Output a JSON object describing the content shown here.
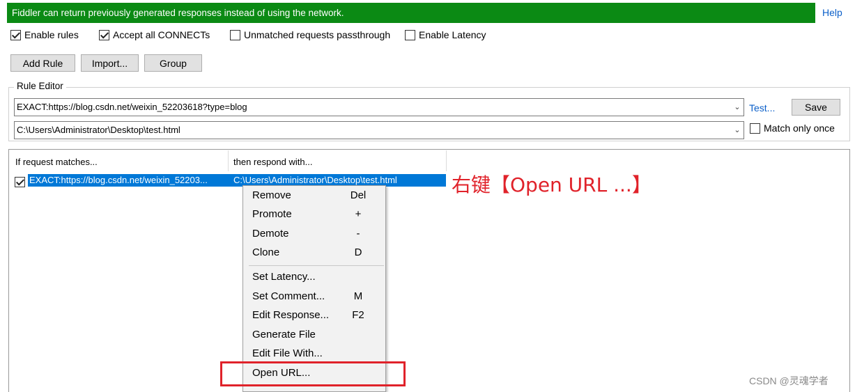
{
  "banner": {
    "text": "Fiddler can return previously generated responses instead of using the network."
  },
  "help": {
    "label": "Help"
  },
  "options": [
    {
      "label": "Enable rules",
      "checked": true
    },
    {
      "label": "Accept all CONNECTs",
      "checked": true
    },
    {
      "label": "Unmatched requests passthrough",
      "checked": false
    },
    {
      "label": "Enable Latency",
      "checked": false
    }
  ],
  "toolbar": {
    "add_rule_label": "Add Rule",
    "import_label": "Import...",
    "group_label": "Group"
  },
  "rule_editor": {
    "title": "Rule Editor",
    "match_value": "EXACT:https://blog.csdn.net/weixin_52203618?type=blog",
    "respond_value": "C:\\Users\\Administrator\\Desktop\\test.html",
    "test_label": "Test...",
    "save_label": "Save",
    "match_only_once_label": "Match only once",
    "match_only_once_checked": false
  },
  "rules_list": {
    "columns": [
      "If request matches...",
      "then respond with..."
    ],
    "rows": [
      {
        "checked": true,
        "match": "EXACT:https://blog.csdn.net/weixin_52203...",
        "respond": "C:\\Users\\Administrator\\Desktop\\test.html",
        "selected": true
      }
    ]
  },
  "annotation": {
    "text": "右键【Open URL ...】",
    "color": "#e0222a"
  },
  "context_menu": {
    "items": [
      {
        "label": "Remove",
        "shortcut": "Del"
      },
      {
        "label": "Promote",
        "shortcut": "+"
      },
      {
        "label": "Demote",
        "shortcut": "-"
      },
      {
        "label": "Clone",
        "shortcut": "D"
      },
      {
        "label": "Set Latency...",
        "shortcut": ""
      },
      {
        "label": "Set Comment...",
        "shortcut": "M"
      },
      {
        "label": "Edit Response...",
        "shortcut": "F2"
      },
      {
        "label": "Generate File",
        "shortcut": ""
      },
      {
        "label": "Edit File With...",
        "shortcut": ""
      },
      {
        "label": "Open URL...",
        "shortcut": ""
      }
    ]
  },
  "watermark": {
    "text": "CSDN @灵魂学者"
  },
  "colors": {
    "banner_bg": "#0b8a14",
    "selection": "#0078d7",
    "link": "#0b5fc9",
    "annotation_red": "#e0222a"
  }
}
